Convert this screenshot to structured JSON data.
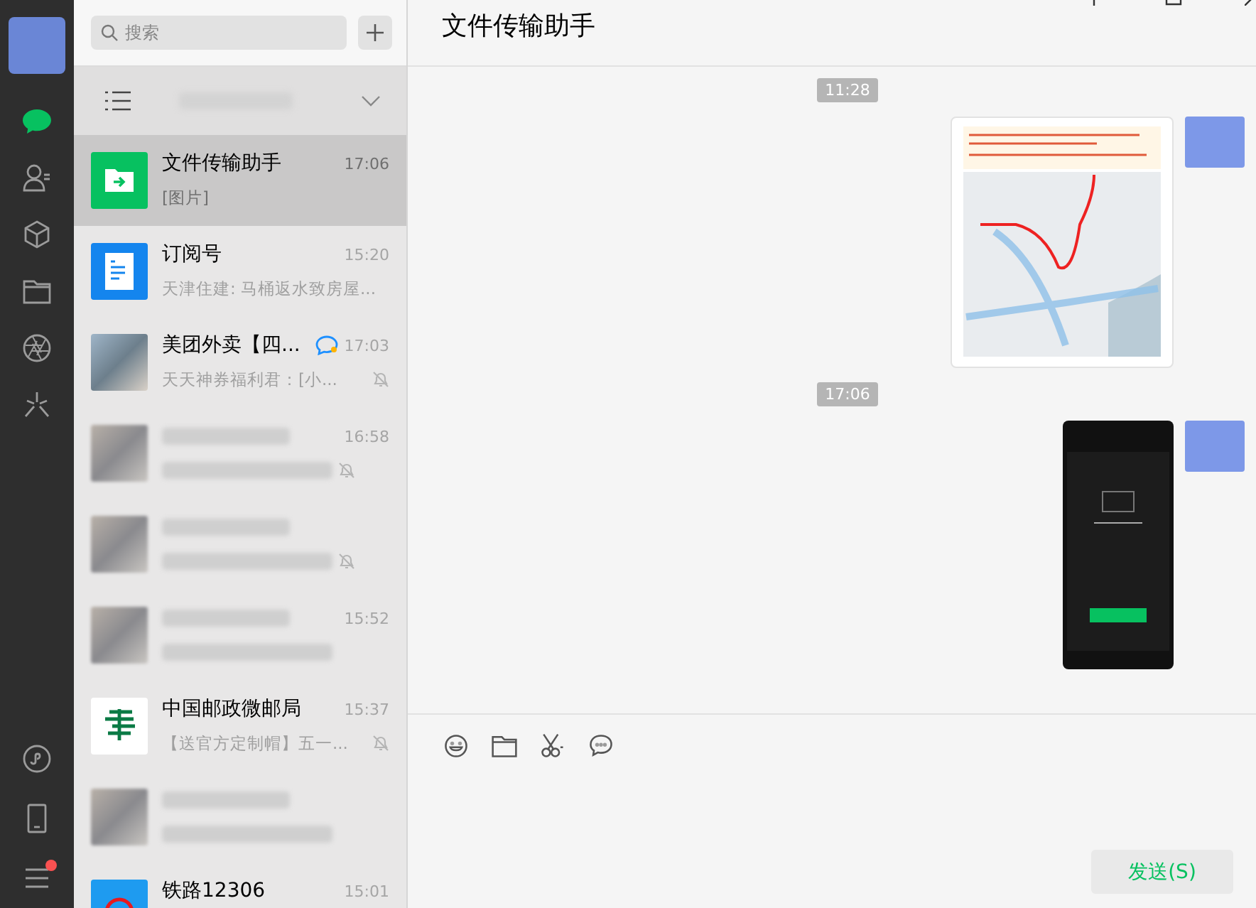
{
  "sidebar": {
    "items": [
      {
        "kind": "chat",
        "selected": true
      },
      {
        "kind": "contacts",
        "selected": false
      },
      {
        "kind": "cube",
        "selected": false
      },
      {
        "kind": "folder",
        "selected": false
      },
      {
        "kind": "aperture",
        "selected": false
      },
      {
        "kind": "sparkle",
        "selected": false
      }
    ],
    "bottom_items": [
      {
        "kind": "miniprogram",
        "badge": false
      },
      {
        "kind": "phone",
        "badge": false
      },
      {
        "kind": "menu",
        "badge": true
      }
    ]
  },
  "search": {
    "placeholder": "搜索"
  },
  "chats": [
    {
      "kind": "file",
      "name": "文件传输助手",
      "time": "17:06",
      "preview": "[图片]",
      "muted": false,
      "selected": true,
      "mention": false
    },
    {
      "kind": "doc",
      "name": "订阅号",
      "time": "15:20",
      "preview": "天津住建: 马桶返水致房屋...",
      "muted": false,
      "selected": false,
      "mention": false
    },
    {
      "kind": "grid",
      "name": "美团外卖【四...",
      "time": "17:03",
      "preview": "天天神券福利君：[小...",
      "muted": true,
      "selected": false,
      "mention": true
    },
    {
      "kind": "blurred",
      "time": "16:58",
      "muted": true,
      "selected": false,
      "mention": false
    },
    {
      "kind": "blurred",
      "muted": true,
      "selected": false,
      "mention": false
    },
    {
      "kind": "blurred",
      "time": "15:52",
      "muted": false,
      "selected": false,
      "mention": false
    },
    {
      "kind": "post",
      "name": "中国邮政微邮局",
      "time": "15:37",
      "preview": "【送官方定制帽】五一...",
      "muted": true,
      "selected": false,
      "mention": false
    },
    {
      "kind": "blurred",
      "muted": false,
      "selected": false,
      "mention": false
    },
    {
      "kind": "rail",
      "name": "铁路12306",
      "time": "15:01",
      "muted": false,
      "selected": false,
      "mention": false
    }
  ],
  "chat": {
    "title": "文件传输助手",
    "messages": [
      {
        "kind": "time",
        "text": "11:28"
      },
      {
        "kind": "map"
      },
      {
        "kind": "time",
        "text": "17:06"
      },
      {
        "kind": "phone"
      }
    ],
    "tools": [
      {
        "kind": "emoji"
      },
      {
        "kind": "folder"
      },
      {
        "kind": "scissors"
      },
      {
        "kind": "bubble"
      }
    ],
    "send_button": "发送(S)"
  }
}
